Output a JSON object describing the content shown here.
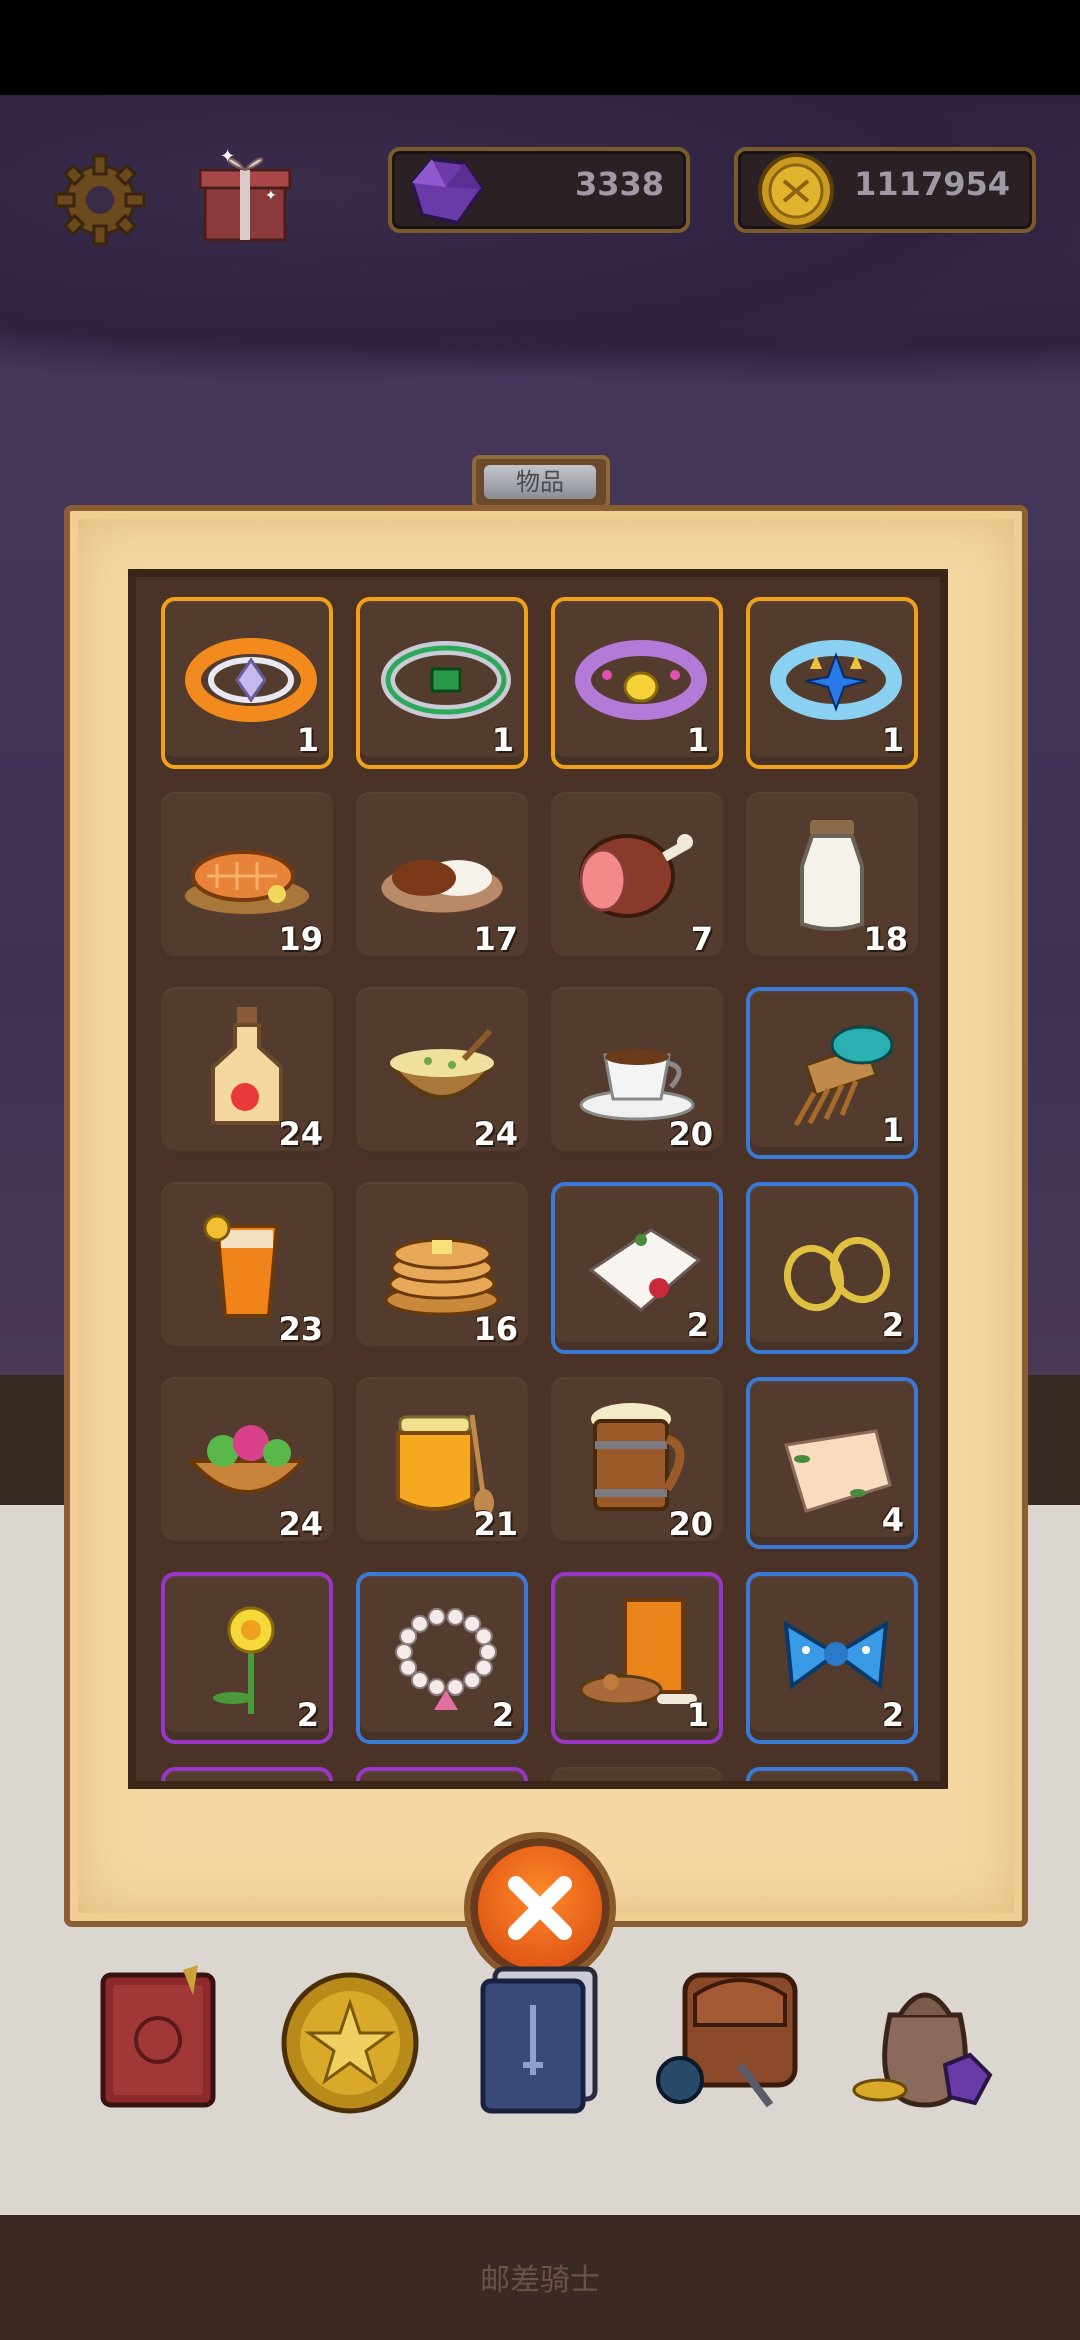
{
  "hud": {
    "gems": "3338",
    "coins": "1117954",
    "settings_icon": "gear-icon",
    "gift_icon": "gift-box-icon"
  },
  "panel": {
    "tab_label": "物品"
  },
  "items": [
    {
      "icon": "orange-ring-icon",
      "count": "1",
      "rarity": "gold"
    },
    {
      "icon": "emerald-ring-icon",
      "count": "1",
      "rarity": "gold"
    },
    {
      "icon": "purple-ring-icon",
      "count": "1",
      "rarity": "gold"
    },
    {
      "icon": "crystal-ring-icon",
      "count": "1",
      "rarity": "gold"
    },
    {
      "icon": "grilled-fish-icon",
      "count": "19",
      "rarity": "none"
    },
    {
      "icon": "curry-rice-icon",
      "count": "17",
      "rarity": "none"
    },
    {
      "icon": "ham-icon",
      "count": "7",
      "rarity": "none"
    },
    {
      "icon": "milk-bottle-icon",
      "count": "18",
      "rarity": "none"
    },
    {
      "icon": "apple-juice-bottle-icon",
      "count": "24",
      "rarity": "none"
    },
    {
      "icon": "soup-bowl-icon",
      "count": "24",
      "rarity": "none"
    },
    {
      "icon": "coffee-cup-icon",
      "count": "20",
      "rarity": "none"
    },
    {
      "icon": "hair-comb-icon",
      "count": "1",
      "rarity": "blue"
    },
    {
      "icon": "iced-tea-icon",
      "count": "23",
      "rarity": "none"
    },
    {
      "icon": "pancakes-icon",
      "count": "16",
      "rarity": "none"
    },
    {
      "icon": "handkerchief-rose-icon",
      "count": "2",
      "rarity": "blue"
    },
    {
      "icon": "gold-earrings-icon",
      "count": "2",
      "rarity": "blue"
    },
    {
      "icon": "salad-bowl-icon",
      "count": "24",
      "rarity": "none"
    },
    {
      "icon": "honey-jar-icon",
      "count": "21",
      "rarity": "none"
    },
    {
      "icon": "beer-mug-icon",
      "count": "20",
      "rarity": "none"
    },
    {
      "icon": "handkerchief-leaf-icon",
      "count": "4",
      "rarity": "blue"
    },
    {
      "icon": "daffodil-icon",
      "count": "2",
      "rarity": "purple"
    },
    {
      "icon": "pearl-bracelet-icon",
      "count": "2",
      "rarity": "blue"
    },
    {
      "icon": "dog-food-icon",
      "count": "1",
      "rarity": "purple"
    },
    {
      "icon": "blue-bow-icon",
      "count": "2",
      "rarity": "blue"
    }
  ],
  "nav": [
    {
      "name": "journal-book-icon"
    },
    {
      "name": "star-coin-icon"
    },
    {
      "name": "card-deck-icon"
    },
    {
      "name": "backpack-icon"
    },
    {
      "name": "treasure-bag-icon"
    }
  ],
  "footer": {
    "app_title": "邮差骑士"
  },
  "colors": {
    "gold_border": "#f0a21b",
    "blue_border": "#3a7ad6",
    "purple_border": "#9a35c9",
    "close_button": "#e8561a"
  }
}
